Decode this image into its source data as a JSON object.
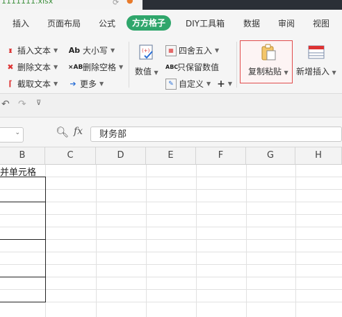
{
  "window": {
    "filename_fragment": "1111111.xlsx"
  },
  "menu": {
    "tabs": [
      {
        "label": "插入",
        "active": false
      },
      {
        "label": "页面布局",
        "active": false
      },
      {
        "label": "公式",
        "active": false
      },
      {
        "label": "方方格子",
        "active": true
      },
      {
        "label": "DIY工具箱",
        "active": false
      },
      {
        "label": "数据",
        "active": false
      },
      {
        "label": "审阅",
        "active": false
      },
      {
        "label": "视图",
        "active": false
      }
    ]
  },
  "ribbon": {
    "text_group": {
      "insert_text": "插入文本",
      "delete_text": "删除文本",
      "extract_text": "截取文本",
      "case": "大小写",
      "delete_spaces": "删除空格",
      "more": "更多"
    },
    "number_group": {
      "value": "数值",
      "round": "四舍五入",
      "keep_numbers": "只保留数值",
      "custom": "自定义"
    },
    "copy_paste": "复制粘贴",
    "new_insert": "新增插入"
  },
  "formula_bar": {
    "fx_label": "fx",
    "value": "财务部"
  },
  "sheet": {
    "columns": [
      "B",
      "C",
      "D",
      "E",
      "F",
      "G",
      "H"
    ],
    "merged_cell_text": "并单元格"
  },
  "colors": {
    "accent_green": "#2fa66b",
    "highlight_red": "#e04b4b"
  }
}
